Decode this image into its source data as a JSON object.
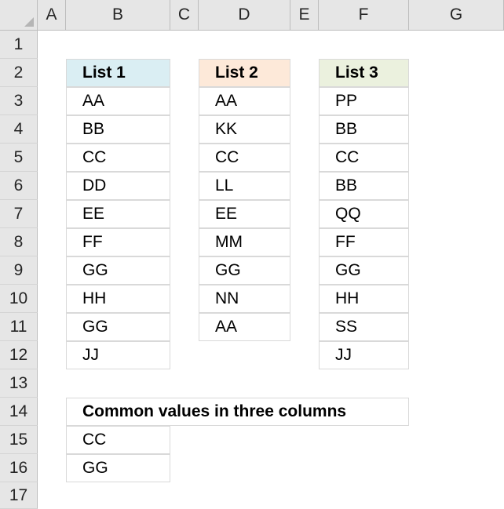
{
  "columns": [
    "A",
    "B",
    "C",
    "D",
    "E",
    "F",
    "G"
  ],
  "rows": [
    "1",
    "2",
    "3",
    "4",
    "5",
    "6",
    "7",
    "8",
    "9",
    "10",
    "11",
    "12",
    "13",
    "14",
    "15",
    "16",
    "17"
  ],
  "list1": {
    "header": "List 1",
    "header_bg": "#daeef3",
    "items": [
      "AA",
      "BB",
      "CC",
      "DD",
      "EE",
      "FF",
      "GG",
      "HH",
      "GG",
      "JJ"
    ]
  },
  "list2": {
    "header": "List 2",
    "header_bg": "#fde9d9",
    "items": [
      "AA",
      "KK",
      "CC",
      "LL",
      "EE",
      "MM",
      "GG",
      "NN",
      "AA"
    ]
  },
  "list3": {
    "header": "List 3",
    "header_bg": "#ebf1de",
    "items": [
      "PP",
      "BB",
      "CC",
      "BB",
      "QQ",
      "FF",
      "GG",
      "HH",
      "SS",
      "JJ"
    ]
  },
  "common": {
    "header": "Common values in three columns",
    "items": [
      "CC",
      "GG"
    ]
  }
}
